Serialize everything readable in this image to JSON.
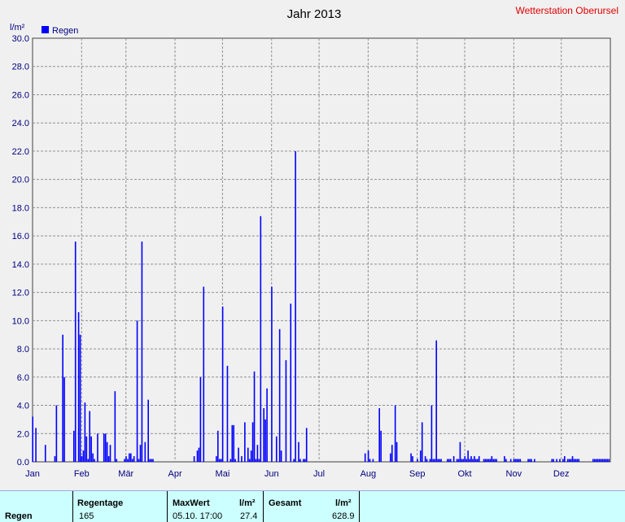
{
  "title": "Jahr 2013",
  "station": "Wetterstation Oberursel",
  "colors": {
    "bar": "#0000ff",
    "station": "#e00000",
    "axis_text": "#000080",
    "plot_bg": "#f0f0f0",
    "grid": "#909090",
    "stats_bg": "#ccffff"
  },
  "chart_data": {
    "type": "bar",
    "ylabel": "l/m²",
    "ylim": [
      0,
      30
    ],
    "yticks": [
      "0.0",
      "2.0",
      "4.0",
      "6.0",
      "8.0",
      "10.0",
      "12.0",
      "14.0",
      "16.0",
      "18.0",
      "20.0",
      "22.0",
      "24.0",
      "26.0",
      "28.0",
      "30.0"
    ],
    "xticks": [
      "Jan",
      "Feb",
      "Mär",
      "Apr",
      "Mai",
      "Jun",
      "Jul",
      "Aug",
      "Sep",
      "Okt",
      "Nov",
      "Dez"
    ],
    "xtick_days": [
      1,
      32,
      60,
      91,
      121,
      152,
      182,
      213,
      244,
      274,
      305,
      335
    ],
    "xlim_days": [
      1,
      366
    ],
    "grid": true,
    "legend_position": "top-left",
    "series": [
      {
        "name": "Regen",
        "days": [
          1,
          3,
          9,
          15,
          16,
          20,
          21,
          27,
          28,
          30,
          31,
          32,
          33,
          34,
          35,
          36,
          37,
          38,
          39,
          40,
          42,
          46,
          47,
          48,
          49,
          50,
          53,
          54,
          59,
          60,
          61,
          62,
          63,
          64,
          65,
          67,
          68,
          69,
          70,
          72,
          74,
          75,
          76,
          77,
          103,
          105,
          106,
          107,
          109,
          117,
          118,
          119,
          120,
          121,
          124,
          126,
          127,
          128,
          129,
          131,
          133,
          135,
          137,
          138,
          139,
          140,
          141,
          142,
          143,
          144,
          145,
          147,
          148,
          149,
          152,
          155,
          157,
          158,
          161,
          164,
          166,
          167,
          169,
          170,
          172,
          173,
          174,
          211,
          213,
          214,
          216,
          220,
          221,
          227,
          228,
          230,
          231,
          240,
          241,
          244,
          246,
          247,
          249,
          250,
          252,
          253,
          254,
          255,
          256,
          257,
          258,
          259,
          263,
          264,
          265,
          267,
          269,
          270,
          271,
          272,
          273,
          274,
          275,
          276,
          277,
          278,
          279,
          280,
          281,
          282,
          283,
          286,
          287,
          288,
          289,
          290,
          291,
          292,
          293,
          294,
          299,
          300,
          303,
          305,
          306,
          307,
          308,
          309,
          314,
          315,
          316,
          318,
          329,
          330,
          332,
          334,
          336,
          337,
          339,
          340,
          341,
          342,
          343,
          344,
          345,
          346,
          355,
          356,
          357,
          358,
          359,
          360,
          361,
          362,
          363,
          364,
          365
        ],
        "values": [
          3.2,
          2.4,
          1.2,
          0.4,
          4.0,
          9.0,
          6.0,
          2.2,
          15.6,
          10.6,
          9.0,
          0.4,
          0.8,
          4.2,
          1.8,
          0.2,
          3.6,
          1.8,
          0.6,
          0.2,
          2.0,
          2.0,
          2.0,
          1.4,
          0.4,
          1.2,
          5.0,
          0.2,
          0.2,
          0.4,
          0.2,
          0.6,
          0.6,
          0.2,
          0.4,
          10.0,
          0.2,
          1.2,
          15.6,
          1.4,
          4.4,
          0.2,
          0.2,
          0.2,
          0.4,
          0.8,
          1.0,
          6.0,
          12.4,
          0.4,
          2.2,
          0.2,
          0.2,
          11.0,
          6.8,
          0.2,
          2.6,
          2.6,
          0.2,
          1.0,
          0.4,
          2.8,
          1.0,
          0.2,
          0.8,
          2.8,
          6.4,
          0.2,
          1.2,
          0.2,
          17.4,
          3.8,
          3.0,
          5.2,
          12.4,
          1.8,
          9.4,
          0.8,
          7.2,
          11.2,
          0.2,
          22.0,
          1.4,
          0.2,
          0.2,
          0.2,
          2.4,
          0.6,
          0.8,
          0.2,
          0.2,
          3.8,
          2.2,
          0.6,
          1.2,
          4.0,
          1.4,
          0.6,
          0.4,
          0.2,
          0.8,
          2.8,
          0.4,
          0.2,
          0.2,
          4.0,
          0.2,
          0.2,
          8.6,
          0.2,
          0.2,
          0.2,
          0.2,
          0.2,
          0.2,
          0.4,
          0.2,
          0.2,
          1.4,
          0.2,
          0.2,
          0.4,
          0.2,
          0.8,
          0.2,
          0.4,
          0.2,
          0.4,
          0.2,
          0.2,
          0.4,
          0.2,
          0.2,
          0.2,
          0.2,
          0.2,
          0.4,
          0.2,
          0.2,
          0.2,
          0.4,
          0.2,
          0.2,
          0.2,
          0.2,
          0.2,
          0.2,
          0.2,
          0.2,
          0.2,
          0.2,
          0.2,
          0.2,
          0.2,
          0.2,
          0.2,
          0.2,
          0.4,
          0.2,
          0.2,
          0.2,
          0.4,
          0.2,
          0.2,
          0.2,
          0.2,
          0.2,
          0.2,
          0.2,
          0.2,
          0.2,
          0.2,
          0.2,
          0.2,
          0.2,
          0.2,
          0.2,
          0.2,
          0.2,
          0.4,
          0.2,
          0.2
        ]
      }
    ]
  },
  "stats": {
    "row_label": "Regen",
    "regentage_label": "Regentage",
    "regentage_value": "165",
    "maxwert_label": "MaxWert",
    "maxwert_unit": "l/m²",
    "maxwert_time": "05.10. 17:00",
    "maxwert_value": "27.4",
    "gesamt_label": "Gesamt",
    "gesamt_unit": "l/m²",
    "gesamt_value": "628.9"
  }
}
